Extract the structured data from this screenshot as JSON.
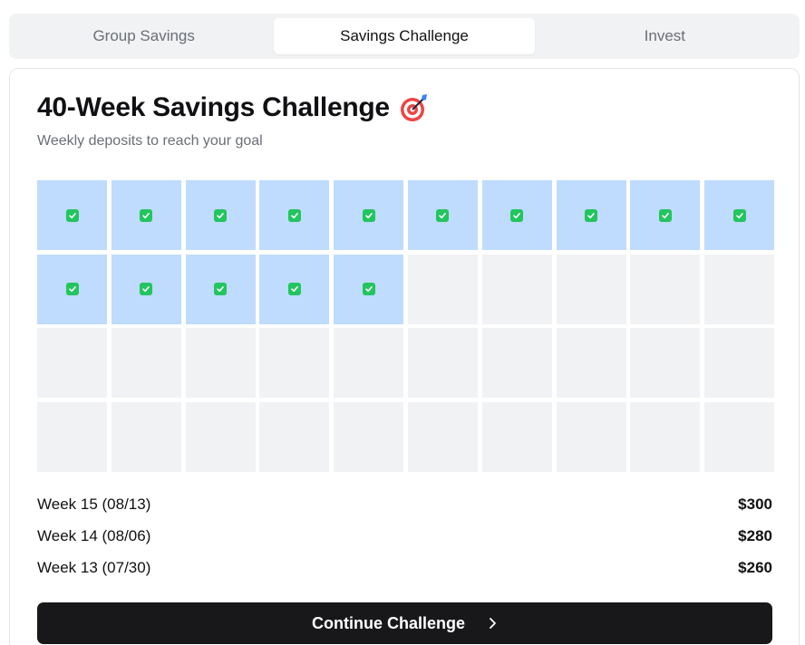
{
  "tabs": [
    {
      "label": "Group Savings",
      "active": false
    },
    {
      "label": "Savings Challenge",
      "active": true
    },
    {
      "label": "Invest",
      "active": false
    }
  ],
  "challenge": {
    "title": "40-Week Savings Challenge",
    "title_icon": "target-emoji",
    "subtitle": "Weekly deposits to reach your goal",
    "total_weeks": 40,
    "completed_weeks": 15,
    "colors": {
      "completed": "#bfdbfe",
      "pending": "#f1f2f4",
      "check": "#22c55e"
    }
  },
  "history": [
    {
      "label": "Week 15 (08/13)",
      "amount": "$300"
    },
    {
      "label": "Week 14 (08/06)",
      "amount": "$280"
    },
    {
      "label": "Week 13 (07/30)",
      "amount": "$260"
    }
  ],
  "cta": {
    "label": "Continue Challenge",
    "icon": "chevron-right-icon"
  }
}
